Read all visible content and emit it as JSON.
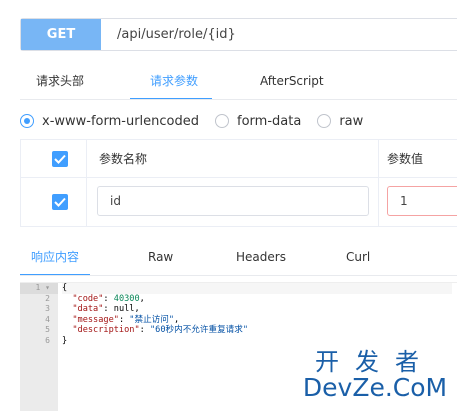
{
  "request": {
    "method": "GET",
    "url": "/api/user/role/{id}"
  },
  "tabs": [
    {
      "label": "请求头部",
      "active": false
    },
    {
      "label": "请求参数",
      "active": true
    },
    {
      "label": "AfterScript",
      "active": false
    }
  ],
  "body_types": [
    {
      "label": "x-www-form-urlencoded",
      "checked": true
    },
    {
      "label": "form-data",
      "checked": false
    },
    {
      "label": "raw",
      "checked": false
    }
  ],
  "params_table": {
    "headers": {
      "name": "参数名称",
      "value": "参数值"
    },
    "rows": [
      {
        "checked": true,
        "name": "id",
        "value": "1"
      }
    ]
  },
  "response_tabs": [
    {
      "label": "响应内容",
      "active": true
    },
    {
      "label": "Raw",
      "active": false
    },
    {
      "label": "Headers",
      "active": false
    },
    {
      "label": "Curl",
      "active": false
    }
  ],
  "response_body": {
    "line_numbers": [
      "1",
      "2",
      "3",
      "4",
      "5",
      "6"
    ],
    "open_brace": "{",
    "close_brace": "}",
    "fields": [
      {
        "key": "\"code\"",
        "value": "40300",
        "kind": "number"
      },
      {
        "key": "\"data\"",
        "value": "null",
        "kind": "plain"
      },
      {
        "key": "\"message\"",
        "value": "\"禁止访问\"",
        "kind": "string"
      },
      {
        "key": "\"description\"",
        "value": "\"60秒内不允许重复请求\"",
        "kind": "string"
      }
    ]
  },
  "watermark": {
    "top": "开发者",
    "bottom": "DevZe.CoM"
  },
  "colors": {
    "accent": "#409eff",
    "method_button": "#78b6f5",
    "watermark": "#1a5fa8"
  }
}
